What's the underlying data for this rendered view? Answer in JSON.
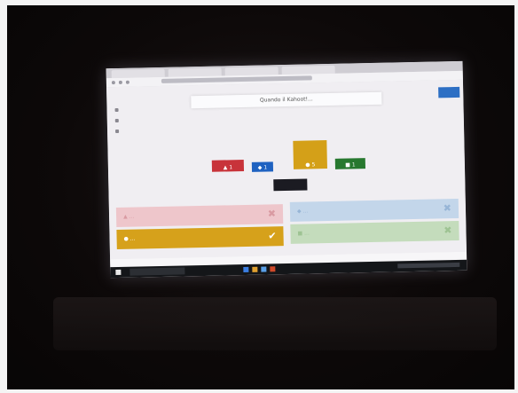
{
  "screen": {
    "question": "Quando il Kahoot!...",
    "results": [
      {
        "shape": "▲",
        "count": "1",
        "color": "#c8333a"
      },
      {
        "shape": "◆",
        "count": "1",
        "color": "#1f62c1"
      },
      {
        "shape": "●",
        "count": "5",
        "color": "#d4a018"
      },
      {
        "shape": "■",
        "count": "1",
        "color": "#27782f"
      }
    ],
    "answers": [
      {
        "shape": "▲",
        "text": "...",
        "mark": "✖"
      },
      {
        "shape": "◆",
        "text": "...",
        "mark": "✖"
      },
      {
        "shape": "●",
        "text": "...",
        "mark": "✔"
      },
      {
        "shape": "■",
        "text": "...",
        "mark": "✖"
      }
    ]
  }
}
